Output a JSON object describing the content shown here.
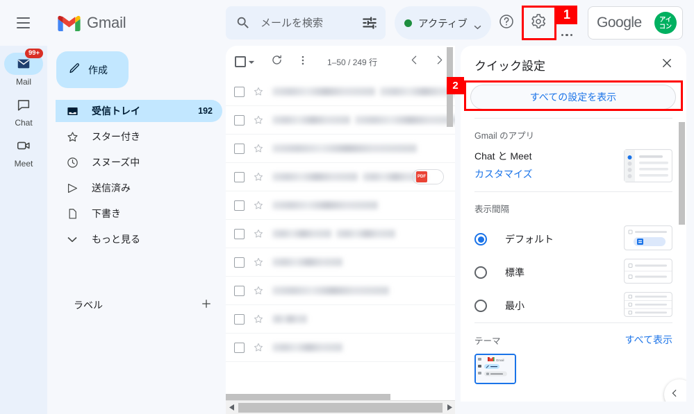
{
  "topbar": {
    "menu_icon": "hamburger-icon",
    "brand": "Gmail",
    "search": {
      "placeholder": "メールを検索",
      "value": "",
      "icon": "search-icon",
      "filter_icon": "tune-icon"
    },
    "status": {
      "label": "アクティブ",
      "dot_color": "#1e8e3e",
      "chevron": "chevron-down-icon"
    },
    "help_icon": "help-circle-icon",
    "settings_icon": "gear-icon",
    "apps_icon": "app-grid-icon",
    "google_button": {
      "label": "Google",
      "avatar_text": "アイ\nコン",
      "avatar_line1": "アイ",
      "avatar_line2": "コン",
      "avatar_color": "#00b060"
    }
  },
  "annotations": [
    {
      "id": "1",
      "target": "settings-gear",
      "color": "#ff0000"
    },
    {
      "id": "2",
      "target": "see-all-settings-button",
      "color": "#ff0000"
    }
  ],
  "rail": {
    "items": [
      {
        "label": "Mail",
        "icon": "mail-icon",
        "badge": "99+",
        "selected": true
      },
      {
        "label": "Chat",
        "icon": "chat-bubble-icon",
        "badge": "",
        "selected": false
      },
      {
        "label": "Meet",
        "icon": "video-camera-icon",
        "badge": "",
        "selected": false
      }
    ]
  },
  "sidebar": {
    "compose": {
      "label": "作成",
      "icon": "pencil-icon"
    },
    "items": [
      {
        "label": "受信トレイ",
        "icon": "inbox-icon",
        "count": "192",
        "selected": true
      },
      {
        "label": "スター付き",
        "icon": "star-icon",
        "count": "",
        "selected": false
      },
      {
        "label": "スヌーズ中",
        "icon": "clock-icon",
        "count": "",
        "selected": false
      },
      {
        "label": "送信済み",
        "icon": "send-icon",
        "count": "",
        "selected": false
      },
      {
        "label": "下書き",
        "icon": "file-icon",
        "count": "",
        "selected": false
      },
      {
        "label": "もっと見る",
        "icon": "chevron-down-icon",
        "count": "",
        "selected": false
      }
    ],
    "labels": {
      "label": "ラベル",
      "add_icon": "plus-icon"
    }
  },
  "maillist": {
    "toolbar": {
      "select_all_icon": "checkbox-icon",
      "select_all_chevron": "chevron-down-icon",
      "refresh_icon": "refresh-icon",
      "more_icon": "more-vertical-icon",
      "range": "1–50 / 249 行",
      "prev_icon": "chevron-left-icon",
      "next_icon": "chevron-right-icon"
    },
    "rows": [
      {
        "widths": [
          148,
          123
        ],
        "attachment": ""
      },
      {
        "widths": [
          112,
          153
        ],
        "attachment": ""
      },
      {
        "widths": [
          208
        ],
        "attachment": ""
      },
      {
        "widths": [
          123,
          90
        ],
        "attachment": "pdf"
      },
      {
        "widths": [
          152
        ],
        "attachment": ""
      },
      {
        "widths": [
          85,
          85
        ],
        "attachment": ""
      },
      {
        "widths": [
          101
        ],
        "attachment": ""
      },
      {
        "widths": [
          168
        ],
        "attachment": ""
      },
      {
        "widths": [
          50
        ],
        "attachment": ""
      },
      {
        "widths": [
          101
        ],
        "attachment": ""
      }
    ],
    "attachment_chip_label": "PDF"
  },
  "quick_settings": {
    "title": "クイック設定",
    "close_icon": "close-icon",
    "see_all_button": "すべての設定を表示",
    "apps_section": {
      "heading": "Gmail のアプリ",
      "app_name": "Chat と Meet",
      "customize_link": "カスタマイズ"
    },
    "density_section": {
      "heading": "表示間隔",
      "options": [
        {
          "label": "デフォルト",
          "selected": true,
          "rows": 1
        },
        {
          "label": "標準",
          "selected": false,
          "rows": 2
        },
        {
          "label": "最小",
          "selected": false,
          "rows": 3
        }
      ]
    },
    "theme_section": {
      "heading": "テーマ",
      "view_all_link": "すべて表示",
      "thumb_brand": "Gmail",
      "selected": true
    }
  },
  "collapse_button": {
    "icon": "chevron-left-icon"
  }
}
